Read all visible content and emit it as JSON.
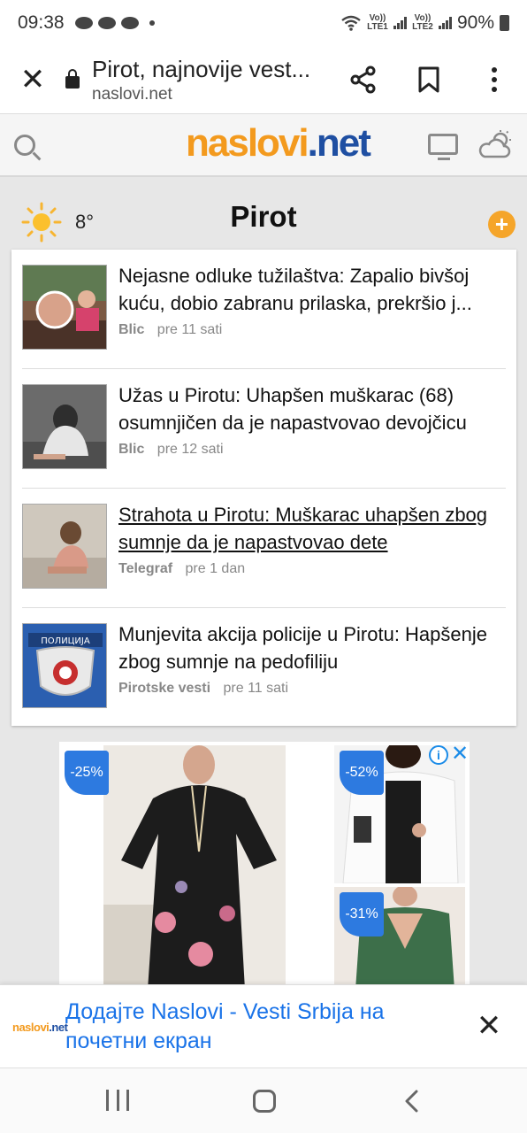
{
  "status_bar": {
    "time": "09:38",
    "sim1": "Vo)) LTE1",
    "sim2": "Vo)) LTE2",
    "battery": "90%"
  },
  "browser": {
    "page_title": "Pirot, najnovije vest...",
    "domain": "naslovi.net",
    "icons": [
      "close-icon",
      "lock-icon",
      "share-icon",
      "bookmark-icon",
      "more-icon"
    ]
  },
  "site": {
    "logo_part1": "naslovi",
    "logo_part2": ".net",
    "icons": [
      "search-icon",
      "monitor-icon",
      "weather-icon"
    ],
    "brand_orange": "#f39a1e",
    "brand_blue": "#1f4fa2"
  },
  "location": {
    "temperature": "8°",
    "city": "Pirot",
    "add_label": "+"
  },
  "news": [
    {
      "headline": "Nejasne odluke tužilaštva: Zapalio bivšoj kuću, dobio zabranu prilaska, prekršio j...",
      "source": "Blic",
      "time": "pre 11 sati",
      "visited": false
    },
    {
      "headline": "Užas u Pirotu: Uhapšen muškarac (68) osumnjičen da je napastvovao devojčicu",
      "source": "Blic",
      "time": "pre 12 sati",
      "visited": false
    },
    {
      "headline": "Strahota u Pirotu: Muškarac uhapšen zbog sumnje da je napastvovao dete",
      "source": "Telegraf",
      "time": "pre 1 dan",
      "visited": true
    },
    {
      "headline": "Munjevita akcija policije u Pirotu: Hapšenje zbog sumnje na pedofiliju",
      "source": "Pirotske vesti",
      "time": "pre 11 sati",
      "visited": false
    }
  ],
  "thumb_text": {
    "police_badge": "ПОЛИЦИЈА"
  },
  "ad": {
    "discount_main": "-25%",
    "discount_side1": "-52%",
    "discount_side2": "-31%",
    "info_label": "i",
    "close_label": "✕",
    "tag_color": "#2d7ae0"
  },
  "install_banner": {
    "mini_logo_part1": "naslovi",
    "mini_logo_part2": ".net",
    "text": "Додајте Naslovi - Vesti Srbija на почетни екран",
    "close_label": "✕"
  }
}
